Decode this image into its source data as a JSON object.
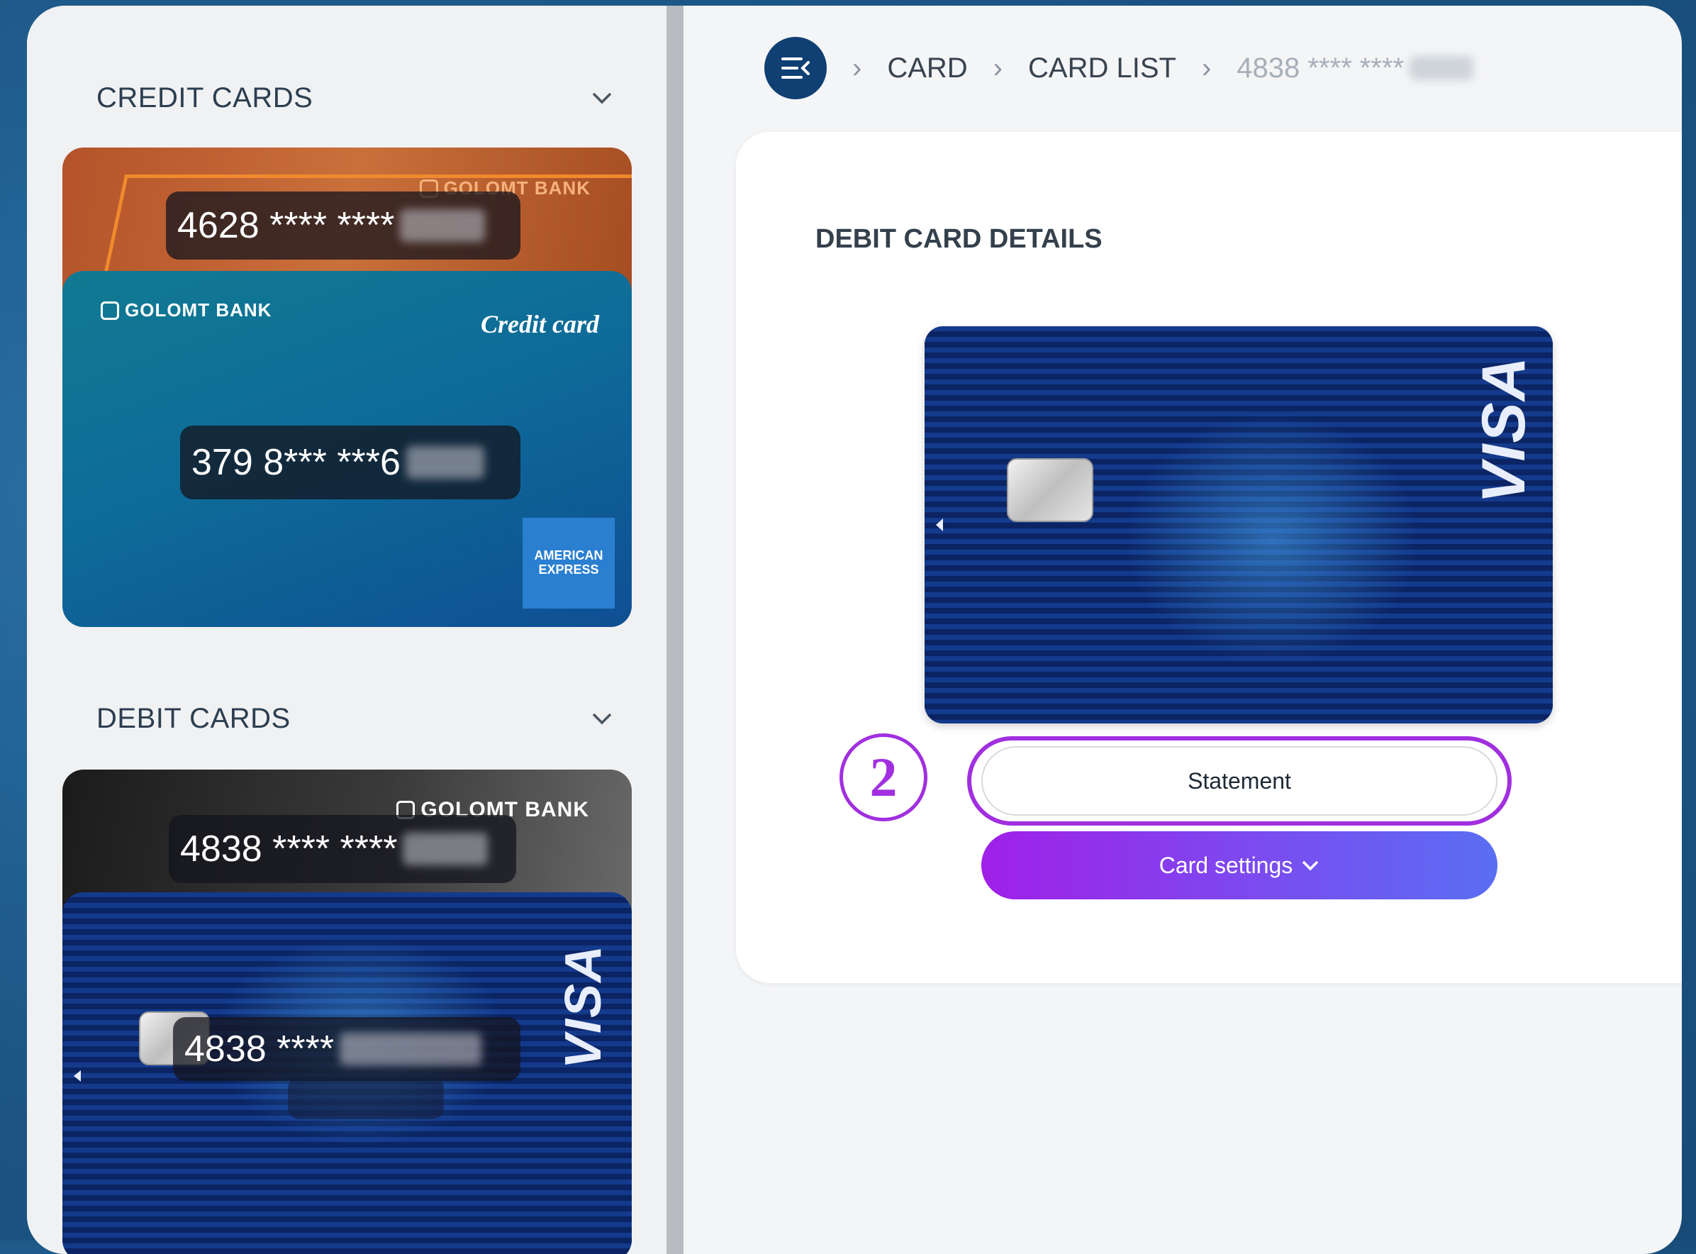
{
  "sidebar": {
    "credit_section_title": "CREDIT CARDS",
    "debit_section_title": "DEBIT CARDS",
    "credit_cards": [
      {
        "number_masked": "4628 **** ****",
        "bank": "GOLOMT BANK"
      },
      {
        "number_masked": "379 8*** ***6",
        "bank": "GOLOMT BANK",
        "type_label": "Credit card",
        "network": "AMERICAN EXPRESS",
        "network_line1": "AMERICAN",
        "network_line2": "EXPRESS"
      }
    ],
    "debit_cards": [
      {
        "number_masked": "4838 **** ****",
        "bank": "GOLOMT BANK"
      },
      {
        "number_masked": "4838 ****",
        "network": "VISA"
      }
    ]
  },
  "breadcrumb": {
    "items": [
      "CARD",
      "CARD LIST"
    ],
    "current": "4838 **** ****"
  },
  "details": {
    "title": "DEBIT CARD DETAILS",
    "card_network": "VISA",
    "statement_label": "Statement",
    "settings_label": "Card settings",
    "annotation_number": "2"
  },
  "colors": {
    "accent_purple": "#a12fe0",
    "nav_button": "#0f3f73"
  }
}
